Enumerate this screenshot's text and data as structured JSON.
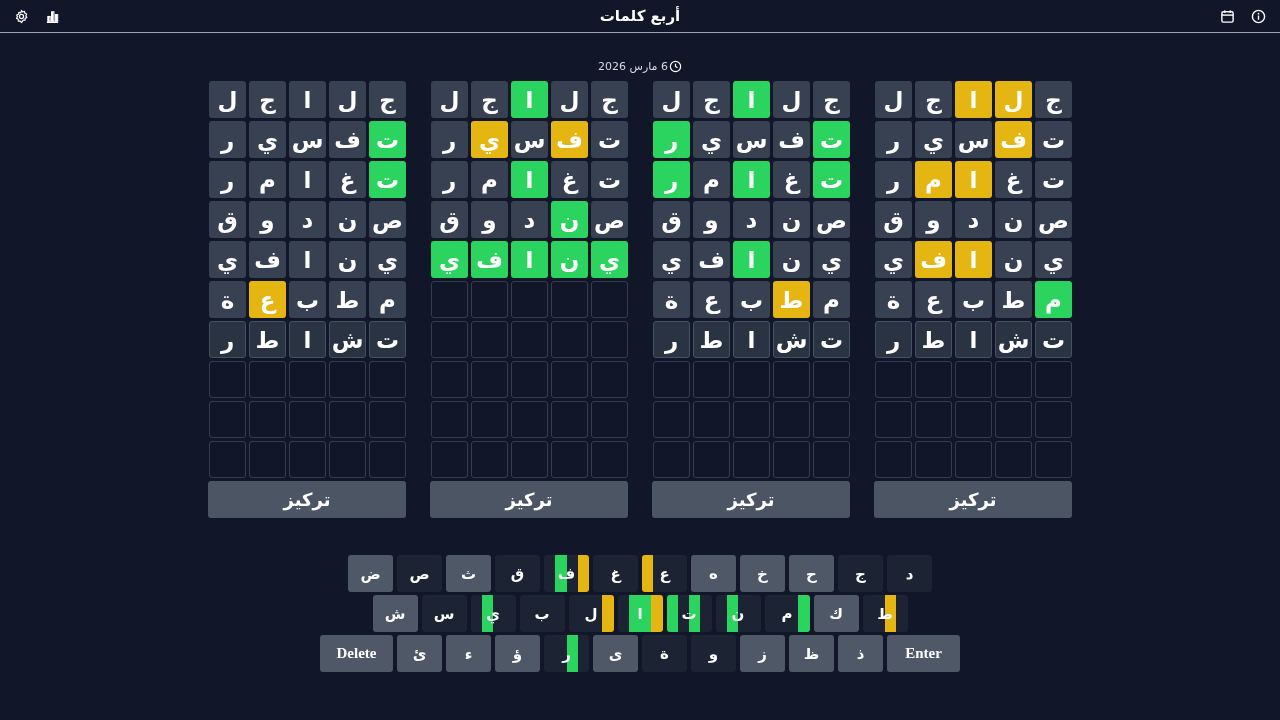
{
  "header": {
    "title": "أربع كلمات"
  },
  "date": {
    "text": "6 مارس 2026"
  },
  "boards": [
    {
      "focus_label": "تركيز",
      "guesses": [
        {
          "tiles": [
            {
              "letter": "ج",
              "kind": "absent"
            },
            {
              "letter": "ل",
              "kind": "present"
            },
            {
              "letter": "ا",
              "kind": "present"
            },
            {
              "letter": "ج",
              "kind": "absent"
            },
            {
              "letter": "ل",
              "kind": "absent"
            }
          ]
        },
        {
          "tiles": [
            {
              "letter": "ت",
              "kind": "absent"
            },
            {
              "letter": "ف",
              "kind": "present"
            },
            {
              "letter": "س",
              "kind": "absent"
            },
            {
              "letter": "ي",
              "kind": "absent"
            },
            {
              "letter": "ر",
              "kind": "absent"
            }
          ]
        },
        {
          "tiles": [
            {
              "letter": "ت",
              "kind": "absent"
            },
            {
              "letter": "غ",
              "kind": "absent"
            },
            {
              "letter": "ا",
              "kind": "present"
            },
            {
              "letter": "م",
              "kind": "present"
            },
            {
              "letter": "ر",
              "kind": "absent"
            }
          ]
        },
        {
          "tiles": [
            {
              "letter": "ص",
              "kind": "absent"
            },
            {
              "letter": "ن",
              "kind": "absent"
            },
            {
              "letter": "د",
              "kind": "absent"
            },
            {
              "letter": "و",
              "kind": "absent"
            },
            {
              "letter": "ق",
              "kind": "absent"
            }
          ]
        },
        {
          "tiles": [
            {
              "letter": "ي",
              "kind": "absent"
            },
            {
              "letter": "ن",
              "kind": "absent"
            },
            {
              "letter": "ا",
              "kind": "present"
            },
            {
              "letter": "ف",
              "kind": "present"
            },
            {
              "letter": "ي",
              "kind": "absent"
            }
          ]
        },
        {
          "tiles": [
            {
              "letter": "م",
              "kind": "correct"
            },
            {
              "letter": "ط",
              "kind": "absent"
            },
            {
              "letter": "ب",
              "kind": "absent"
            },
            {
              "letter": "ع",
              "kind": "absent"
            },
            {
              "letter": "ة",
              "kind": "absent"
            }
          ]
        },
        {
          "tiles": [
            {
              "letter": "ت",
              "kind": "typed"
            },
            {
              "letter": "ش",
              "kind": "typed"
            },
            {
              "letter": "ا",
              "kind": "typed"
            },
            {
              "letter": "ط",
              "kind": "typed"
            },
            {
              "letter": "ر",
              "kind": "typed"
            }
          ]
        }
      ]
    },
    {
      "focus_label": "تركيز",
      "guesses": [
        {
          "tiles": [
            {
              "letter": "ج",
              "kind": "absent"
            },
            {
              "letter": "ل",
              "kind": "absent"
            },
            {
              "letter": "ا",
              "kind": "correct"
            },
            {
              "letter": "ج",
              "kind": "absent"
            },
            {
              "letter": "ل",
              "kind": "absent"
            }
          ]
        },
        {
          "tiles": [
            {
              "letter": "ت",
              "kind": "correct"
            },
            {
              "letter": "ف",
              "kind": "absent"
            },
            {
              "letter": "س",
              "kind": "absent"
            },
            {
              "letter": "ي",
              "kind": "absent"
            },
            {
              "letter": "ر",
              "kind": "correct"
            }
          ]
        },
        {
          "tiles": [
            {
              "letter": "ت",
              "kind": "correct"
            },
            {
              "letter": "غ",
              "kind": "absent"
            },
            {
              "letter": "ا",
              "kind": "correct"
            },
            {
              "letter": "م",
              "kind": "absent"
            },
            {
              "letter": "ر",
              "kind": "correct"
            }
          ]
        },
        {
          "tiles": [
            {
              "letter": "ص",
              "kind": "absent"
            },
            {
              "letter": "ن",
              "kind": "absent"
            },
            {
              "letter": "د",
              "kind": "absent"
            },
            {
              "letter": "و",
              "kind": "absent"
            },
            {
              "letter": "ق",
              "kind": "absent"
            }
          ]
        },
        {
          "tiles": [
            {
              "letter": "ي",
              "kind": "absent"
            },
            {
              "letter": "ن",
              "kind": "absent"
            },
            {
              "letter": "ا",
              "kind": "correct"
            },
            {
              "letter": "ف",
              "kind": "absent"
            },
            {
              "letter": "ي",
              "kind": "absent"
            }
          ]
        },
        {
          "tiles": [
            {
              "letter": "م",
              "kind": "absent"
            },
            {
              "letter": "ط",
              "kind": "present"
            },
            {
              "letter": "ب",
              "kind": "absent"
            },
            {
              "letter": "ع",
              "kind": "absent"
            },
            {
              "letter": "ة",
              "kind": "absent"
            }
          ]
        },
        {
          "tiles": [
            {
              "letter": "ت",
              "kind": "typed"
            },
            {
              "letter": "ش",
              "kind": "typed"
            },
            {
              "letter": "ا",
              "kind": "typed"
            },
            {
              "letter": "ط",
              "kind": "typed"
            },
            {
              "letter": "ر",
              "kind": "typed"
            }
          ]
        }
      ]
    },
    {
      "focus_label": "تركيز",
      "guesses": [
        {
          "tiles": [
            {
              "letter": "ج",
              "kind": "absent"
            },
            {
              "letter": "ل",
              "kind": "absent"
            },
            {
              "letter": "ا",
              "kind": "correct"
            },
            {
              "letter": "ج",
              "kind": "absent"
            },
            {
              "letter": "ل",
              "kind": "absent"
            }
          ]
        },
        {
          "tiles": [
            {
              "letter": "ت",
              "kind": "absent"
            },
            {
              "letter": "ف",
              "kind": "present"
            },
            {
              "letter": "س",
              "kind": "absent"
            },
            {
              "letter": "ي",
              "kind": "present"
            },
            {
              "letter": "ر",
              "kind": "absent"
            }
          ]
        },
        {
          "tiles": [
            {
              "letter": "ت",
              "kind": "absent"
            },
            {
              "letter": "غ",
              "kind": "absent"
            },
            {
              "letter": "ا",
              "kind": "correct"
            },
            {
              "letter": "م",
              "kind": "absent"
            },
            {
              "letter": "ر",
              "kind": "absent"
            }
          ]
        },
        {
          "tiles": [
            {
              "letter": "ص",
              "kind": "absent"
            },
            {
              "letter": "ن",
              "kind": "correct"
            },
            {
              "letter": "د",
              "kind": "absent"
            },
            {
              "letter": "و",
              "kind": "absent"
            },
            {
              "letter": "ق",
              "kind": "absent"
            }
          ]
        },
        {
          "tiles": [
            {
              "letter": "ي",
              "kind": "correct"
            },
            {
              "letter": "ن",
              "kind": "correct"
            },
            {
              "letter": "ا",
              "kind": "correct"
            },
            {
              "letter": "ف",
              "kind": "correct"
            },
            {
              "letter": "ي",
              "kind": "correct"
            }
          ]
        }
      ]
    },
    {
      "focus_label": "تركيز",
      "guesses": [
        {
          "tiles": [
            {
              "letter": "ج",
              "kind": "absent"
            },
            {
              "letter": "ل",
              "kind": "absent"
            },
            {
              "letter": "ا",
              "kind": "absent"
            },
            {
              "letter": "ج",
              "kind": "absent"
            },
            {
              "letter": "ل",
              "kind": "absent"
            }
          ]
        },
        {
          "tiles": [
            {
              "letter": "ت",
              "kind": "correct"
            },
            {
              "letter": "ف",
              "kind": "absent"
            },
            {
              "letter": "س",
              "kind": "absent"
            },
            {
              "letter": "ي",
              "kind": "absent"
            },
            {
              "letter": "ر",
              "kind": "absent"
            }
          ]
        },
        {
          "tiles": [
            {
              "letter": "ت",
              "kind": "correct"
            },
            {
              "letter": "غ",
              "kind": "absent"
            },
            {
              "letter": "ا",
              "kind": "absent"
            },
            {
              "letter": "م",
              "kind": "absent"
            },
            {
              "letter": "ر",
              "kind": "absent"
            }
          ]
        },
        {
          "tiles": [
            {
              "letter": "ص",
              "kind": "absent"
            },
            {
              "letter": "ن",
              "kind": "absent"
            },
            {
              "letter": "د",
              "kind": "absent"
            },
            {
              "letter": "و",
              "kind": "absent"
            },
            {
              "letter": "ق",
              "kind": "absent"
            }
          ]
        },
        {
          "tiles": [
            {
              "letter": "ي",
              "kind": "absent"
            },
            {
              "letter": "ن",
              "kind": "absent"
            },
            {
              "letter": "ا",
              "kind": "absent"
            },
            {
              "letter": "ف",
              "kind": "absent"
            },
            {
              "letter": "ي",
              "kind": "absent"
            }
          ]
        },
        {
          "tiles": [
            {
              "letter": "م",
              "kind": "absent"
            },
            {
              "letter": "ط",
              "kind": "absent"
            },
            {
              "letter": "ب",
              "kind": "absent"
            },
            {
              "letter": "ع",
              "kind": "present"
            },
            {
              "letter": "ة",
              "kind": "absent"
            }
          ]
        },
        {
          "tiles": [
            {
              "letter": "ت",
              "kind": "typed"
            },
            {
              "letter": "ش",
              "kind": "typed"
            },
            {
              "letter": "ا",
              "kind": "typed"
            },
            {
              "letter": "ط",
              "kind": "typed"
            },
            {
              "letter": "ر",
              "kind": "typed"
            }
          ]
        }
      ]
    }
  ],
  "keyboard": {
    "rows": [
      {
        "keys": [
          {
            "label": "د",
            "kind": "letter",
            "used": true
          },
          {
            "label": "ج",
            "kind": "letter",
            "used": true
          },
          {
            "label": "ح",
            "kind": "letter",
            "used": false
          },
          {
            "label": "خ",
            "kind": "letter",
            "used": false
          },
          {
            "label": "ه",
            "kind": "letter",
            "used": false
          },
          {
            "label": "ع",
            "kind": "letter",
            "used": true,
            "boards": [
              {
                "kind": "none"
              },
              {
                "kind": "none"
              },
              {
                "kind": "none"
              },
              {
                "kind": "present"
              }
            ]
          },
          {
            "label": "غ",
            "kind": "letter",
            "used": true
          },
          {
            "label": "ف",
            "kind": "letter",
            "used": true,
            "boards": [
              {
                "kind": "present"
              },
              {
                "kind": "none"
              },
              {
                "kind": "correct"
              },
              {
                "kind": "none"
              }
            ]
          },
          {
            "label": "ق",
            "kind": "letter",
            "used": true
          },
          {
            "label": "ث",
            "kind": "letter",
            "used": false
          },
          {
            "label": "ص",
            "kind": "letter",
            "used": true
          },
          {
            "label": "ض",
            "kind": "letter",
            "used": false
          }
        ]
      },
      {
        "keys": [
          {
            "label": "ط",
            "kind": "letter",
            "used": true,
            "boards": [
              {
                "kind": "none"
              },
              {
                "kind": "present"
              },
              {
                "kind": "none"
              },
              {
                "kind": "none"
              }
            ]
          },
          {
            "label": "ك",
            "kind": "letter",
            "used": false
          },
          {
            "label": "م",
            "kind": "letter",
            "used": true,
            "boards": [
              {
                "kind": "correct"
              },
              {
                "kind": "none"
              },
              {
                "kind": "none"
              },
              {
                "kind": "none"
              }
            ]
          },
          {
            "label": "ن",
            "kind": "letter",
            "used": true,
            "boards": [
              {
                "kind": "none"
              },
              {
                "kind": "none"
              },
              {
                "kind": "correct"
              },
              {
                "kind": "none"
              }
            ]
          },
          {
            "label": "ت",
            "kind": "letter",
            "used": true,
            "boards": [
              {
                "kind": "none"
              },
              {
                "kind": "correct"
              },
              {
                "kind": "none"
              },
              {
                "kind": "correct"
              }
            ]
          },
          {
            "label": "ا",
            "kind": "letter",
            "used": true,
            "boards": [
              {
                "kind": "present"
              },
              {
                "kind": "correct"
              },
              {
                "kind": "correct"
              },
              {
                "kind": "none"
              }
            ]
          },
          {
            "label": "ل",
            "kind": "letter",
            "used": true,
            "boards": [
              {
                "kind": "present"
              },
              {
                "kind": "none"
              },
              {
                "kind": "none"
              },
              {
                "kind": "none"
              }
            ]
          },
          {
            "label": "ب",
            "kind": "letter",
            "used": true
          },
          {
            "label": "ي",
            "kind": "letter",
            "used": true,
            "boards": [
              {
                "kind": "none"
              },
              {
                "kind": "none"
              },
              {
                "kind": "correct"
              },
              {
                "kind": "none"
              }
            ]
          },
          {
            "label": "س",
            "kind": "letter",
            "used": true
          },
          {
            "label": "ش",
            "kind": "letter",
            "used": false
          }
        ]
      },
      {
        "keys": [
          {
            "label": "Enter",
            "kind": "action",
            "used": false
          },
          {
            "label": "ذ",
            "kind": "letter",
            "used": false
          },
          {
            "label": "ظ",
            "kind": "letter",
            "used": false
          },
          {
            "label": "ز",
            "kind": "letter",
            "used": false
          },
          {
            "label": "و",
            "kind": "letter",
            "used": true
          },
          {
            "label": "ة",
            "kind": "letter",
            "used": true
          },
          {
            "label": "ى",
            "kind": "letter",
            "used": false
          },
          {
            "label": "ر",
            "kind": "letter",
            "used": true,
            "boards": [
              {
                "kind": "none"
              },
              {
                "kind": "correct"
              },
              {
                "kind": "none"
              },
              {
                "kind": "none"
              }
            ]
          },
          {
            "label": "ؤ",
            "kind": "letter",
            "used": false
          },
          {
            "label": "ء",
            "kind": "letter",
            "used": false
          },
          {
            "label": "ئ",
            "kind": "letter",
            "used": false
          },
          {
            "label": "Delete",
            "kind": "action",
            "used": false
          }
        ]
      }
    ]
  }
}
